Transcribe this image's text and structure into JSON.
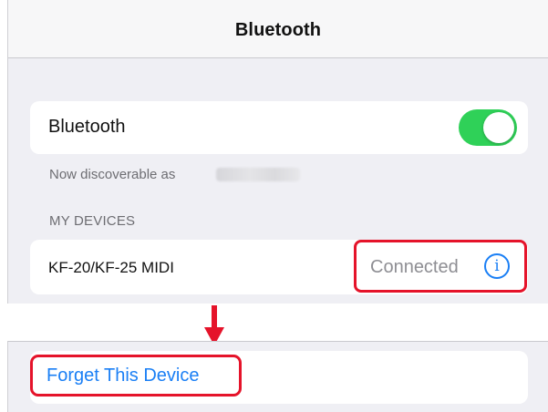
{
  "navbar": {
    "title": "Bluetooth"
  },
  "bluetooth_row": {
    "label": "Bluetooth",
    "toggle_state": "on",
    "toggle_color": "#2fd158"
  },
  "discoverable": {
    "text": "Now discoverable as"
  },
  "my_devices": {
    "header": "MY DEVICES",
    "items": [
      {
        "name": "KF-20/KF-25 MIDI",
        "status": "Connected",
        "info_icon": "info-circle-icon",
        "info_glyph": "i"
      }
    ]
  },
  "forget_action": {
    "label": "Forget This Device"
  },
  "annotations": {
    "highlight_color": "#e5132a",
    "arrow_icon": "arrow-down-icon"
  },
  "colors": {
    "accent": "#1a7ff5",
    "background": "#efeff4",
    "card": "#ffffff",
    "secondary_text": "#6d6d72"
  }
}
